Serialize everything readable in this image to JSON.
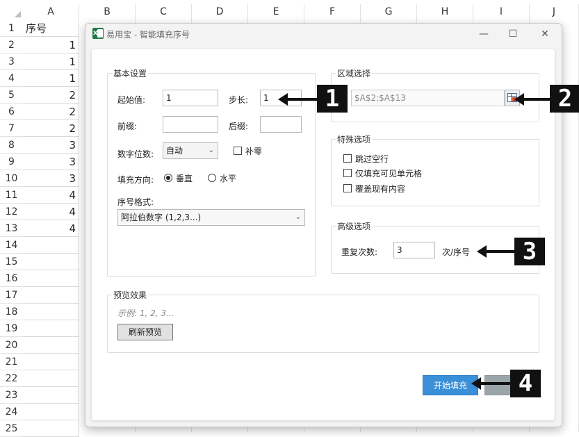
{
  "sheet": {
    "columns": [
      "A",
      "B",
      "C",
      "D",
      "E",
      "F",
      "G",
      "H",
      "I",
      "J"
    ],
    "rows": [
      "1",
      "2",
      "3",
      "4",
      "5",
      "6",
      "7",
      "8",
      "9",
      "10",
      "11",
      "12",
      "13",
      "14",
      "15",
      "16",
      "17",
      "18",
      "19",
      "20",
      "21",
      "22",
      "23",
      "24",
      "25"
    ],
    "colA": [
      "序号",
      "1",
      "1",
      "1",
      "2",
      "2",
      "2",
      "3",
      "3",
      "3",
      "4",
      "4",
      "4"
    ]
  },
  "dialog": {
    "title": "易用宝 - 智能填充序号",
    "app_icon_letter": "x",
    "controls": {
      "minimize": "—",
      "maximize": "☐",
      "close": "✕"
    }
  },
  "basic": {
    "legend": "基本设置",
    "start_label": "起始值:",
    "start_value": "1",
    "step_label": "步长:",
    "step_value": "1",
    "prefix_label": "前缀:",
    "prefix_value": "",
    "suffix_label": "后缀:",
    "suffix_value": "",
    "digits_label": "数字位数:",
    "digits_value": "自动",
    "pad_zero_label": "补零",
    "direction_label": "填充方向:",
    "vertical_label": "垂直",
    "horizontal_label": "水平",
    "format_label": "序号格式:",
    "format_value": "阿拉伯数字 (1,2,3...)"
  },
  "region": {
    "legend": "区域选择",
    "range_value": "$A$2:$A$13"
  },
  "special": {
    "legend": "特殊选项",
    "options": [
      "跳过空行",
      "仅填充可见单元格",
      "覆盖现有内容"
    ]
  },
  "advanced": {
    "legend": "高级选项",
    "repeat_label": "重复次数:",
    "repeat_value": "3",
    "repeat_unit": "次/序号"
  },
  "preview": {
    "legend": "预览效果",
    "example": "示例: 1, 2, 3...",
    "refresh_label": "刷新预览"
  },
  "actions": {
    "start_fill_label": "开始填充"
  },
  "annotations": [
    "1",
    "2",
    "3",
    "4"
  ],
  "colors": {
    "primary_button": "#3a8fd8",
    "secondary_button": "#9aa5aa",
    "excel_green": "#1d7a45"
  }
}
